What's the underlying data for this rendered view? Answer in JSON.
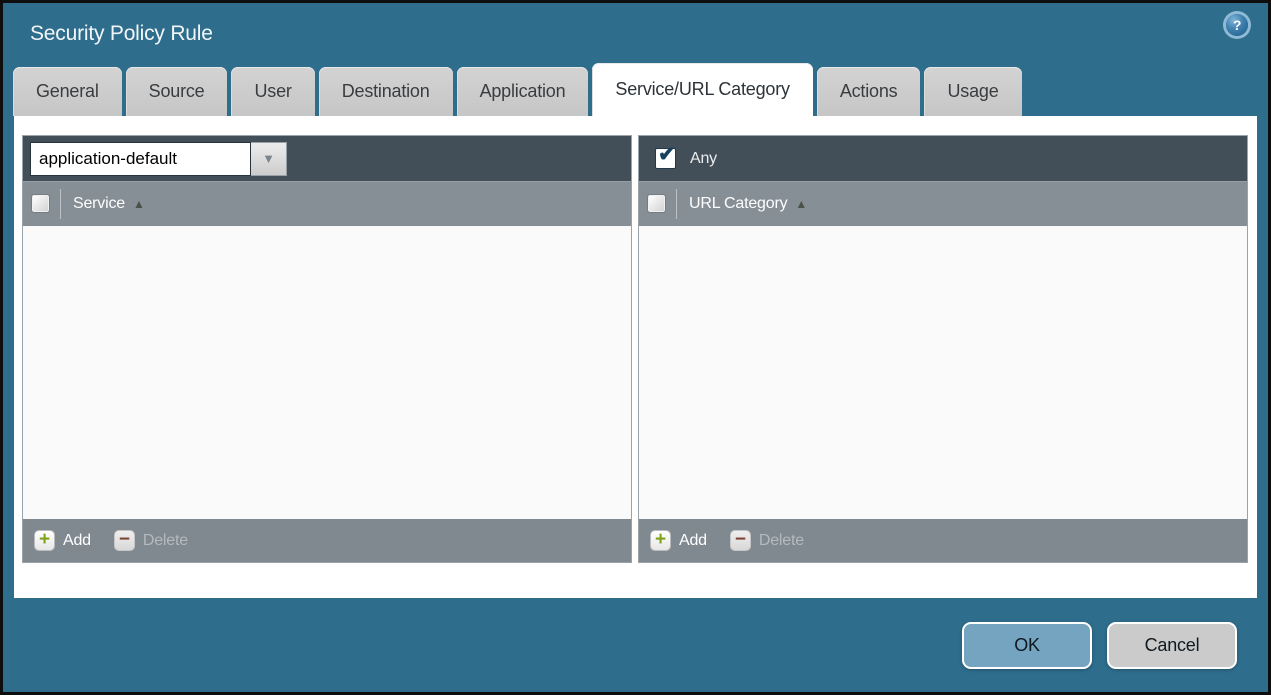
{
  "window": {
    "title": "Security Policy Rule"
  },
  "tabs": [
    {
      "label": "General",
      "active": false
    },
    {
      "label": "Source",
      "active": false
    },
    {
      "label": "User",
      "active": false
    },
    {
      "label": "Destination",
      "active": false
    },
    {
      "label": "Application",
      "active": false
    },
    {
      "label": "Service/URL Category",
      "active": true
    },
    {
      "label": "Actions",
      "active": false
    },
    {
      "label": "Usage",
      "active": false
    }
  ],
  "service_panel": {
    "dropdown": {
      "value": "application-default"
    },
    "header": {
      "label": "Service",
      "checkbox_checked": false,
      "sorted": "ascending"
    },
    "rows": [],
    "footer": {
      "add_label": "Add",
      "delete_label": "Delete",
      "add_enabled": true,
      "delete_enabled": false
    }
  },
  "url_panel": {
    "any": {
      "label": "Any",
      "checked": true
    },
    "header": {
      "label": "URL Category",
      "checkbox_checked": false,
      "sorted": "ascending"
    },
    "rows": [],
    "footer": {
      "add_label": "Add",
      "delete_label": "Delete",
      "add_enabled": true,
      "delete_enabled": false
    }
  },
  "actions": {
    "ok_label": "OK",
    "cancel_label": "Cancel"
  },
  "icons": {
    "help": "?",
    "dropdown_arrow": "▼",
    "sort_ascending": "▲",
    "check": "✔",
    "plus": "+",
    "minus": "−"
  },
  "colors": {
    "titlebar_background": "#2e6d8c",
    "toolbar_row": "#424f58",
    "header_row": "#878f96",
    "footer_row": "#7f898f",
    "active_tab": "#ffffff",
    "inactive_tab": "#c9c9c9",
    "ok_button": "#74a4bf",
    "cancel_button": "#cbcbcb",
    "add_plus": "#7fa317",
    "delete_minus": "#7d4437"
  }
}
